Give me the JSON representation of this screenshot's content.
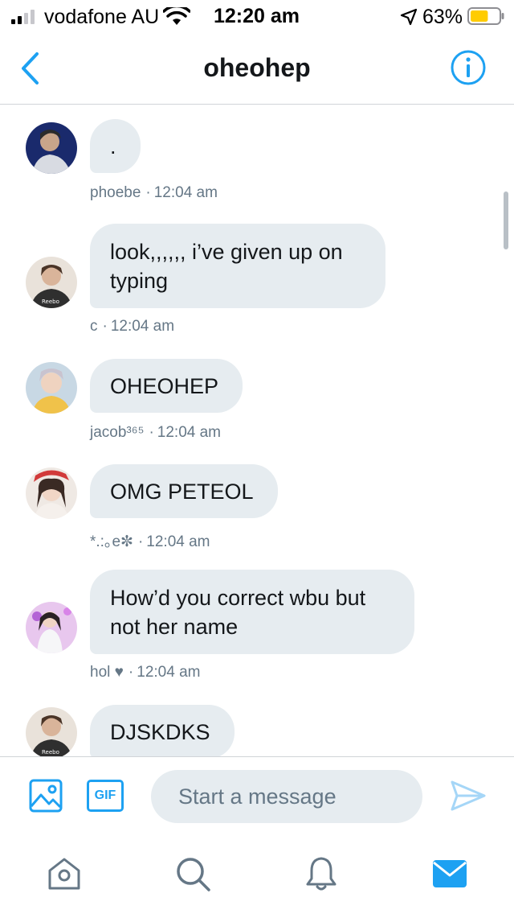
{
  "status_bar": {
    "carrier": "vodafone AU",
    "time": "12:20 am",
    "battery_percent": "63%",
    "battery_level": 0.63
  },
  "header": {
    "title": "oheohep",
    "back_icon": "chevron-left-icon",
    "info_icon": "info-icon"
  },
  "colors": {
    "accent": "#1da1f2",
    "bubble": "#e6ecf0",
    "meta_text": "#657786",
    "battery_fill": "#ffcc00"
  },
  "messages": [
    {
      "avatar": "avatar-phoebe",
      "text": ".",
      "author": "phoebe",
      "time": "12:04 am"
    },
    {
      "avatar": "avatar-c",
      "text": "look,,,,,, i’ve given up on typing",
      "author": "c",
      "time": "12:04 am"
    },
    {
      "avatar": "avatar-jacob",
      "text": "OHEOHEP",
      "author": "jacob³⁶⁵",
      "time": "12:04 am"
    },
    {
      "avatar": "avatar-e",
      "text": "OMG PETEOL",
      "author": "*.:｡e✼",
      "time": "12:04 am"
    },
    {
      "avatar": "avatar-hol",
      "text": "How’d you correct wbu but not her name",
      "author": "hol ♥",
      "time": "12:04 am"
    },
    {
      "avatar": "avatar-c",
      "text": "DJSKDKS",
      "author": "",
      "time": ""
    }
  ],
  "composer": {
    "placeholder": "Start a message",
    "gif_label": "GIF"
  },
  "tabbar": {
    "items": [
      "home-icon",
      "search-icon",
      "notifications-icon",
      "messages-icon"
    ],
    "active": "messages-icon"
  }
}
